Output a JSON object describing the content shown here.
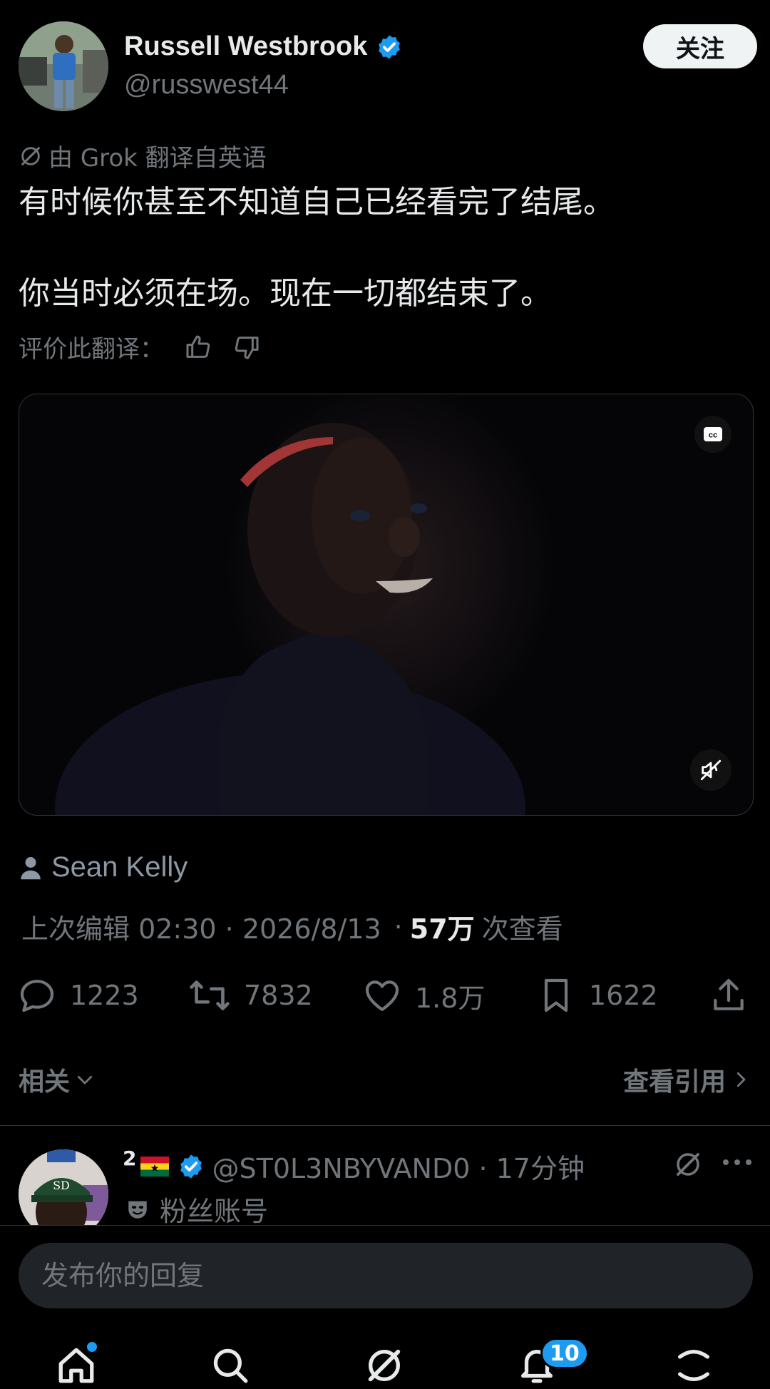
{
  "author": {
    "name": "Russell Westbrook",
    "handle": "@russwest44",
    "follow_label": "关注"
  },
  "translation": {
    "translated_by": "由 Grok 翻译自英语",
    "text_line1": "有时候你甚至不知道自己已经看完了结尾。",
    "text_line2": "你当时必须在场。现在一切都结束了。",
    "rate_label": "评价此翻译："
  },
  "media": {
    "cc_icon": "cc-icon",
    "mute_icon": "speaker-muted-icon"
  },
  "credit": "Sean Kelly",
  "meta": {
    "edited": "上次编辑 02:30 · 2026/8/13",
    "separator": "·",
    "views_count": "57万",
    "views_label": "次查看"
  },
  "actions": {
    "replies": "1223",
    "reposts": "7832",
    "likes": "1.8万",
    "bookmarks": "1622"
  },
  "related_label": "相关",
  "view_quotes_label": "查看引用",
  "reply": {
    "superscript": "2",
    "handle_time": "@ST0L3NBYVAND0 · 17分钟",
    "account_label": "粉丝账号"
  },
  "compose": {
    "placeholder": "发布你的回复"
  },
  "nav": {
    "notifications_badge": "10"
  },
  "colors": {
    "accent": "#1d9bf0",
    "background": "#000000",
    "text": "#e7e9ea",
    "muted": "#71767b"
  }
}
